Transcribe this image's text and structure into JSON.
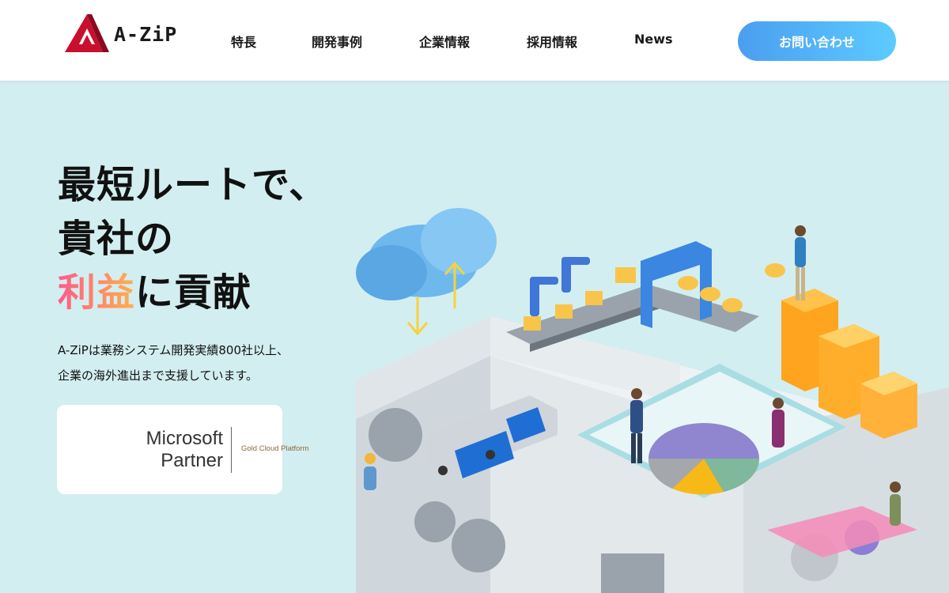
{
  "header": {
    "logo_text": "A-ZiP",
    "nav": [
      {
        "label": "特長"
      },
      {
        "label": "開発事例"
      },
      {
        "label": "企業情報"
      },
      {
        "label": "採用情報"
      },
      {
        "label": "News"
      }
    ],
    "contact_label": "お問い合わせ"
  },
  "hero": {
    "headline_line1": "最短ルートで、",
    "headline_line2": "貴社の",
    "headline_highlight": "利益",
    "headline_line3_rest": "に貢献",
    "desc_line1": "A-ZiPは業務システム開発実績800社以上、",
    "desc_line2": "企業の海外進出まで支援しています。"
  },
  "partner_badge": {
    "line1": "Microsoft",
    "line2": "Partner",
    "tier": "Gold Cloud Platform"
  },
  "colors": {
    "background": "#d3eef0",
    "accent_blue": "#4b9ef0",
    "logo_red": "#c8102e",
    "highlight_pink": "#ff5a8a",
    "highlight_orange": "#ffb14a"
  }
}
